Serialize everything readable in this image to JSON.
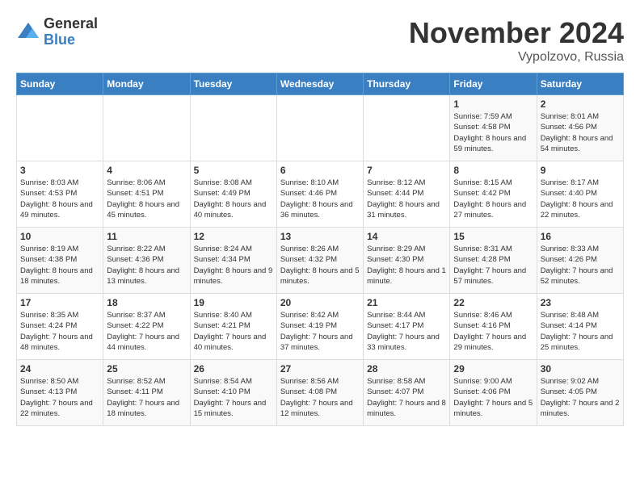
{
  "logo": {
    "general": "General",
    "blue": "Blue"
  },
  "title": "November 2024",
  "location": "Vypolzovo, Russia",
  "days_of_week": [
    "Sunday",
    "Monday",
    "Tuesday",
    "Wednesday",
    "Thursday",
    "Friday",
    "Saturday"
  ],
  "weeks": [
    [
      {
        "day": "",
        "info": ""
      },
      {
        "day": "",
        "info": ""
      },
      {
        "day": "",
        "info": ""
      },
      {
        "day": "",
        "info": ""
      },
      {
        "day": "",
        "info": ""
      },
      {
        "day": "1",
        "info": "Sunrise: 7:59 AM\nSunset: 4:58 PM\nDaylight: 8 hours and 59 minutes."
      },
      {
        "day": "2",
        "info": "Sunrise: 8:01 AM\nSunset: 4:56 PM\nDaylight: 8 hours and 54 minutes."
      }
    ],
    [
      {
        "day": "3",
        "info": "Sunrise: 8:03 AM\nSunset: 4:53 PM\nDaylight: 8 hours and 49 minutes."
      },
      {
        "day": "4",
        "info": "Sunrise: 8:06 AM\nSunset: 4:51 PM\nDaylight: 8 hours and 45 minutes."
      },
      {
        "day": "5",
        "info": "Sunrise: 8:08 AM\nSunset: 4:49 PM\nDaylight: 8 hours and 40 minutes."
      },
      {
        "day": "6",
        "info": "Sunrise: 8:10 AM\nSunset: 4:46 PM\nDaylight: 8 hours and 36 minutes."
      },
      {
        "day": "7",
        "info": "Sunrise: 8:12 AM\nSunset: 4:44 PM\nDaylight: 8 hours and 31 minutes."
      },
      {
        "day": "8",
        "info": "Sunrise: 8:15 AM\nSunset: 4:42 PM\nDaylight: 8 hours and 27 minutes."
      },
      {
        "day": "9",
        "info": "Sunrise: 8:17 AM\nSunset: 4:40 PM\nDaylight: 8 hours and 22 minutes."
      }
    ],
    [
      {
        "day": "10",
        "info": "Sunrise: 8:19 AM\nSunset: 4:38 PM\nDaylight: 8 hours and 18 minutes."
      },
      {
        "day": "11",
        "info": "Sunrise: 8:22 AM\nSunset: 4:36 PM\nDaylight: 8 hours and 13 minutes."
      },
      {
        "day": "12",
        "info": "Sunrise: 8:24 AM\nSunset: 4:34 PM\nDaylight: 8 hours and 9 minutes."
      },
      {
        "day": "13",
        "info": "Sunrise: 8:26 AM\nSunset: 4:32 PM\nDaylight: 8 hours and 5 minutes."
      },
      {
        "day": "14",
        "info": "Sunrise: 8:29 AM\nSunset: 4:30 PM\nDaylight: 8 hours and 1 minute."
      },
      {
        "day": "15",
        "info": "Sunrise: 8:31 AM\nSunset: 4:28 PM\nDaylight: 7 hours and 57 minutes."
      },
      {
        "day": "16",
        "info": "Sunrise: 8:33 AM\nSunset: 4:26 PM\nDaylight: 7 hours and 52 minutes."
      }
    ],
    [
      {
        "day": "17",
        "info": "Sunrise: 8:35 AM\nSunset: 4:24 PM\nDaylight: 7 hours and 48 minutes."
      },
      {
        "day": "18",
        "info": "Sunrise: 8:37 AM\nSunset: 4:22 PM\nDaylight: 7 hours and 44 minutes."
      },
      {
        "day": "19",
        "info": "Sunrise: 8:40 AM\nSunset: 4:21 PM\nDaylight: 7 hours and 40 minutes."
      },
      {
        "day": "20",
        "info": "Sunrise: 8:42 AM\nSunset: 4:19 PM\nDaylight: 7 hours and 37 minutes."
      },
      {
        "day": "21",
        "info": "Sunrise: 8:44 AM\nSunset: 4:17 PM\nDaylight: 7 hours and 33 minutes."
      },
      {
        "day": "22",
        "info": "Sunrise: 8:46 AM\nSunset: 4:16 PM\nDaylight: 7 hours and 29 minutes."
      },
      {
        "day": "23",
        "info": "Sunrise: 8:48 AM\nSunset: 4:14 PM\nDaylight: 7 hours and 25 minutes."
      }
    ],
    [
      {
        "day": "24",
        "info": "Sunrise: 8:50 AM\nSunset: 4:13 PM\nDaylight: 7 hours and 22 minutes."
      },
      {
        "day": "25",
        "info": "Sunrise: 8:52 AM\nSunset: 4:11 PM\nDaylight: 7 hours and 18 minutes."
      },
      {
        "day": "26",
        "info": "Sunrise: 8:54 AM\nSunset: 4:10 PM\nDaylight: 7 hours and 15 minutes."
      },
      {
        "day": "27",
        "info": "Sunrise: 8:56 AM\nSunset: 4:08 PM\nDaylight: 7 hours and 12 minutes."
      },
      {
        "day": "28",
        "info": "Sunrise: 8:58 AM\nSunset: 4:07 PM\nDaylight: 7 hours and 8 minutes."
      },
      {
        "day": "29",
        "info": "Sunrise: 9:00 AM\nSunset: 4:06 PM\nDaylight: 7 hours and 5 minutes."
      },
      {
        "day": "30",
        "info": "Sunrise: 9:02 AM\nSunset: 4:05 PM\nDaylight: 7 hours and 2 minutes."
      }
    ]
  ]
}
